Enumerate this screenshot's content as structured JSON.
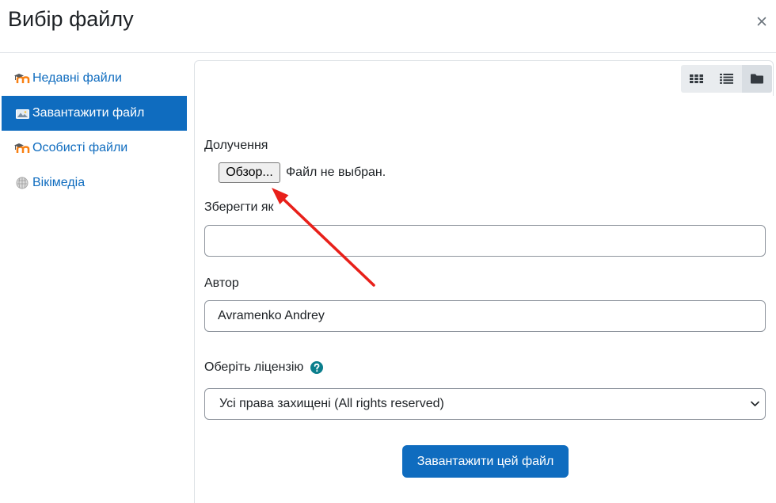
{
  "dialog": {
    "title": "Вибір файлу",
    "close_icon": "close-icon"
  },
  "sidebar": {
    "items": [
      {
        "label": "Недавні файли",
        "icon": "moodle-icon",
        "active": false
      },
      {
        "label": "Завантажити файл",
        "icon": "upload-image-icon",
        "active": true
      },
      {
        "label": "Особисті файли",
        "icon": "moodle-icon",
        "active": false
      },
      {
        "label": "Вікімедіа",
        "icon": "wikimedia-icon",
        "active": false
      }
    ]
  },
  "toolbar": {
    "view_buttons": [
      {
        "icon": "grid-view-icon",
        "active": false
      },
      {
        "icon": "list-view-icon",
        "active": false
      },
      {
        "icon": "folder-view-icon",
        "active": true
      }
    ]
  },
  "upload_form": {
    "attachment": {
      "label": "Долучення",
      "browse_button_label": "Обзор...",
      "status_text": "Файл не выбран."
    },
    "save_as": {
      "label": "Зберегти як",
      "value": ""
    },
    "author": {
      "label": "Автор",
      "value": "Avramenko Andrey"
    },
    "license": {
      "label": "Оберіть ліцензію",
      "help_icon": "question-circle-icon",
      "selected": "Усі права захищені (All rights reserved)"
    },
    "submit_label": "Завантажити цей файл"
  },
  "colors": {
    "accent": "#0f6cbf",
    "help_icon": "#0a7e8c",
    "annotation_arrow": "#e8201a"
  }
}
